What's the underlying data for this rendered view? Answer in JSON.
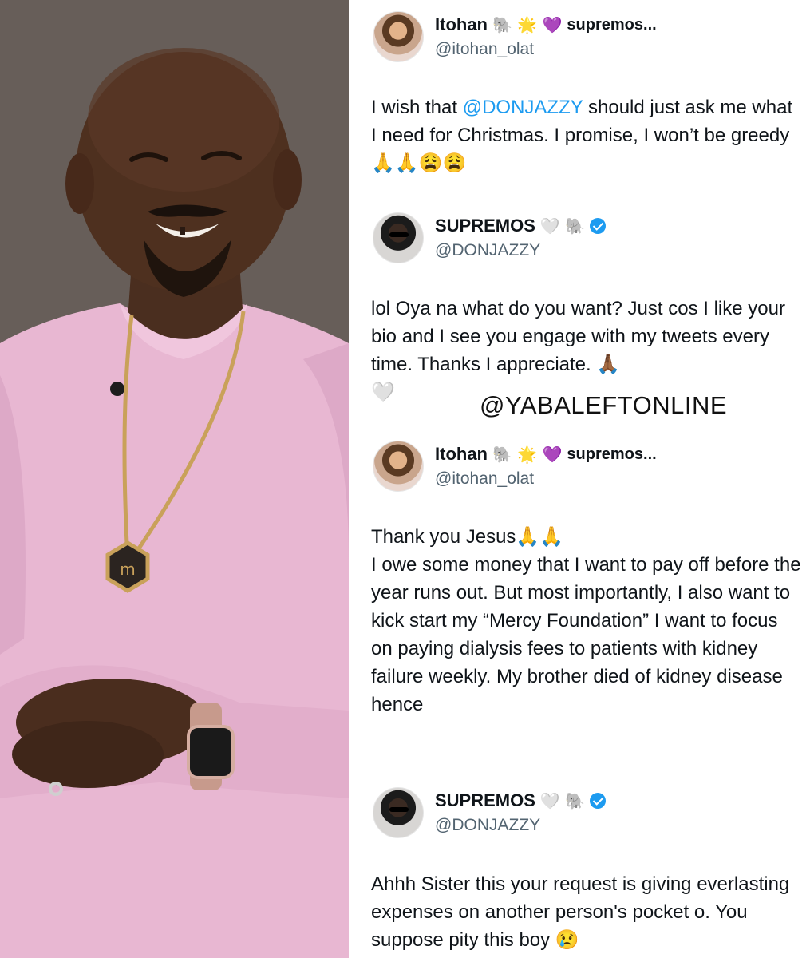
{
  "watermark": "@YABALEFTONLINE",
  "tweets": [
    {
      "name": "Itohan",
      "name_emojis": "🐘 🌟 💜",
      "name_suffix": "supremos...",
      "handle": "@itohan_olat",
      "mention": "@DONJAZZY",
      "text_before": "I wish that ",
      "text_after": " should just ask me what I need for Christmas. I promise, I won’t be greedy 🙏🙏😩😩"
    },
    {
      "name": "SUPREMOS",
      "name_emojis": "🤍 🐘",
      "handle": "@DONJAZZY",
      "text": "lol Oya na what do you want? Just cos I like your bio and I see you engage with my tweets every time. Thanks I appreciate. 🙏🏾\n🤍"
    },
    {
      "name": "Itohan",
      "name_emojis": "🐘 🌟 💜",
      "name_suffix": "supremos...",
      "handle": "@itohan_olat",
      "text": "Thank you Jesus🙏🙏\nI owe some money that I want to pay off before the year runs out. But most importantly, I also want to kick start my “Mercy Foundation” I want to focus on paying dialysis fees to patients with kidney failure weekly. My brother died of kidney disease hence"
    },
    {
      "name": "SUPREMOS",
      "name_emojis": "🤍 🐘",
      "handle": "@DONJAZZY",
      "text": "Ahhh Sister this your request is giving everlasting expenses on another person's pocket o. You suppose pity this boy 😢"
    }
  ],
  "colors": {
    "link": "#1d9bf0",
    "handle": "#536471",
    "text": "#0f1419",
    "shirt": "#e8b7d2"
  }
}
